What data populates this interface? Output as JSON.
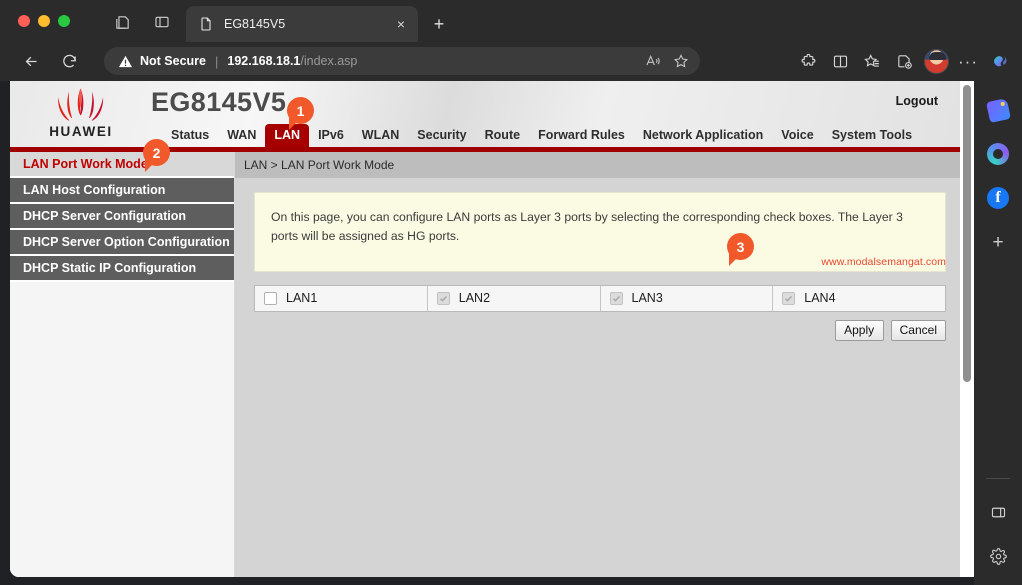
{
  "browser": {
    "tab": {
      "title": "EG8145V5",
      "favicon": "page-icon",
      "close": "×"
    },
    "new_tab": "+",
    "omnibox": {
      "security_label": "Not Secure",
      "separator": "|",
      "host": "192.168.18.1",
      "path": "/index.asp"
    },
    "toolbar_icons": [
      "back-icon",
      "reload-icon",
      "read-aloud-icon",
      "favorite-star-icon",
      "extensions-icon",
      "split-screen-icon",
      "collections-icon",
      "add-favorites-icon",
      "profile-avatar",
      "settings-more-icon",
      "copilot-icon"
    ],
    "more_dots": "···"
  },
  "router": {
    "brand": "HUAWEI",
    "model": "EG8145V5",
    "logout_label": "Logout",
    "nav": [
      {
        "label": "Status",
        "active": false
      },
      {
        "label": "WAN",
        "active": false
      },
      {
        "label": "LAN",
        "active": true
      },
      {
        "label": "IPv6",
        "active": false
      },
      {
        "label": "WLAN",
        "active": false
      },
      {
        "label": "Security",
        "active": false
      },
      {
        "label": "Route",
        "active": false
      },
      {
        "label": "Forward Rules",
        "active": false
      },
      {
        "label": "Network Application",
        "active": false
      },
      {
        "label": "Voice",
        "active": false
      },
      {
        "label": "System Tools",
        "active": false
      }
    ],
    "sidebar": [
      {
        "label": "LAN Port Work Mode",
        "active": true
      },
      {
        "label": "LAN Host Configuration",
        "active": false
      },
      {
        "label": "DHCP Server Configuration",
        "active": false
      },
      {
        "label": "DHCP Server Option Configuration",
        "active": false
      },
      {
        "label": "DHCP Static IP Configuration",
        "active": false
      }
    ],
    "breadcrumb": "LAN > LAN Port Work Mode",
    "info_text": "On this page, you can configure LAN ports as Layer 3 ports by selecting the corresponding check boxes. The Layer 3 ports will be assigned as HG ports.",
    "watermark": "www.modalsemangat.com",
    "ports": [
      {
        "label": "LAN1",
        "checked": false,
        "disabled": false
      },
      {
        "label": "LAN2",
        "checked": true,
        "disabled": true
      },
      {
        "label": "LAN3",
        "checked": true,
        "disabled": true
      },
      {
        "label": "LAN4",
        "checked": true,
        "disabled": true
      }
    ],
    "buttons": {
      "apply": "Apply",
      "cancel": "Cancel"
    }
  },
  "edge_rail": {
    "items": [
      "shopping-tag-icon",
      "copilot-icon",
      "facebook-icon",
      "add-site-icon"
    ],
    "plus": "+",
    "bottom": [
      "panel-toggle-icon",
      "rail-settings-gear-icon"
    ]
  },
  "callouts": [
    {
      "number": "1"
    },
    {
      "number": "2"
    },
    {
      "number": "3"
    }
  ],
  "colors": {
    "brand_red": "#a60000",
    "accent_rule": "#a00000",
    "callout": "#f1592a",
    "watermark": "#e8472e",
    "chrome": "#2b2b2b"
  }
}
